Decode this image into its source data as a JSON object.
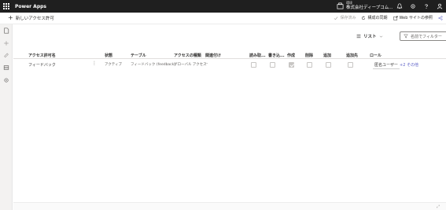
{
  "topbar": {
    "app_name": "Power Apps",
    "environment_label": "環境",
    "environment_name": "株式会社ディープコム..."
  },
  "commandbar": {
    "new_label": "新しいアクセス許可",
    "save_label": "保存済み",
    "sync_label": "構成の同期",
    "browse_site_label": "Web サイトの参照"
  },
  "view": {
    "view_label": "リスト",
    "filter_placeholder": "名前でフィルター"
  },
  "table": {
    "columns": [
      "アクセス許可名",
      "状態",
      "テーブル",
      "アクセスの種類",
      "関連付け",
      "読み取...",
      "書き込...",
      "作成",
      "削除",
      "追加",
      "追加先",
      "ロール"
    ],
    "rows": [
      {
        "name": "フィードバック",
        "status": "アクティブ",
        "table": "フィードバック (feedback)",
        "access_type": "グローバル アクセス",
        "relation": "--",
        "read": false,
        "write": false,
        "create": true,
        "delete": false,
        "append": false,
        "append_to": false,
        "role": "匿名ユーザー",
        "role_more": "+2 その他"
      }
    ]
  },
  "colors": {
    "topbar_bg": "#1f1f1f",
    "accent": "#5b5fc7"
  }
}
